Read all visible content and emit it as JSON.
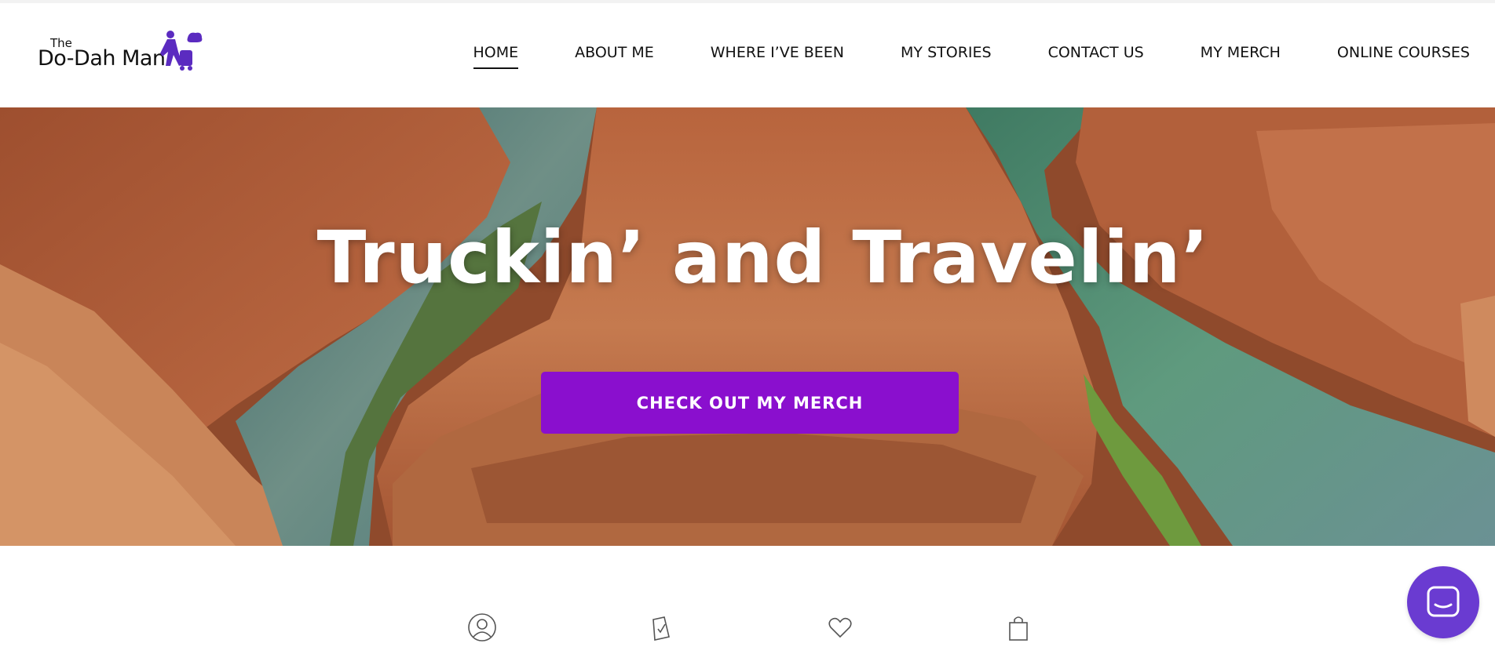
{
  "logo": {
    "the": "The",
    "main": "Do-Dah Man",
    "icon": "traveler-icon"
  },
  "nav": {
    "items": [
      {
        "label": "HOME",
        "active": true
      },
      {
        "label": "ABOUT ME",
        "active": false
      },
      {
        "label": "WHERE I’VE BEEN",
        "active": false
      },
      {
        "label": "MY STORIES",
        "active": false
      },
      {
        "label": "CONTACT US",
        "active": false
      },
      {
        "label": "MY MERCH",
        "active": false
      },
      {
        "label": "ONLINE COURSES",
        "active": false
      }
    ]
  },
  "hero": {
    "title": "Truckin’ and Travelin’",
    "cta_label": "CHECK OUT MY MERCH",
    "image": "horseshoe-bend-canyon-image"
  },
  "icons_row": {
    "items": [
      {
        "icon": "user-icon"
      },
      {
        "icon": "checklist-icon"
      },
      {
        "icon": "heart-icon"
      },
      {
        "icon": "shopping-bag-icon"
      }
    ]
  },
  "chat": {
    "icon": "chat-icon"
  },
  "colors": {
    "accent": "#8a0fce",
    "logo_purple": "#5b2bc0",
    "chat_bg": "#6a3bd1",
    "text": "#111111"
  }
}
